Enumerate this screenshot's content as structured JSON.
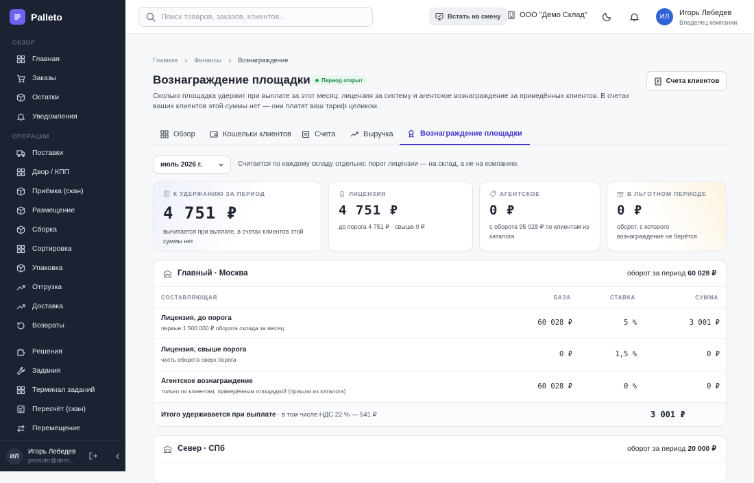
{
  "app": {
    "name": "Palleto"
  },
  "sidebar": {
    "section_overview": "ОБЗОР",
    "section_ops": "ОПЕРАЦИИ",
    "overview_items": [
      {
        "label": "Главная"
      },
      {
        "label": "Заказы"
      },
      {
        "label": "Остатки"
      },
      {
        "label": "Уведомления"
      }
    ],
    "ops_items": [
      {
        "label": "Поставки"
      },
      {
        "label": "Двор / КПП"
      },
      {
        "label": "Приёмка (скан)"
      },
      {
        "label": "Размещение"
      },
      {
        "label": "Сборка"
      },
      {
        "label": "Сортировка"
      },
      {
        "label": "Упаковка"
      },
      {
        "label": "Отгрузка"
      },
      {
        "label": "Доставка"
      },
      {
        "label": "Возвраты"
      }
    ],
    "other_items": [
      {
        "label": "Решения"
      },
      {
        "label": "Задания"
      },
      {
        "label": "Терминал заданий"
      },
      {
        "label": "Пересчёт (скан)"
      },
      {
        "label": "Перемещение"
      }
    ],
    "user": {
      "initials": "ИЛ",
      "name": "Игорь Лебедев",
      "email": "provider@dem..."
    }
  },
  "topbar": {
    "search_placeholder": "Поиск товаров, заказов, клиентов...",
    "shift_label": "Встать на смену",
    "org": "ООО \"Демо Склад\"",
    "user": {
      "initials": "ИЛ",
      "name": "Игорь Лебедев",
      "role": "Владелец компании"
    }
  },
  "breadcrumbs": [
    "Главная",
    "Финансы",
    "Вознаграждение"
  ],
  "page": {
    "title": "Вознаграждение площадки",
    "badge": "Период открыт",
    "description": "Сколько площадка удержит при выплате за этот месяц: лицензия за систему и агентское вознаграждение за приведённых клиентов. В счетах ваших клиентов этой суммы нет — они платят ваш тариф целиком.",
    "accounts_button": "Счета клиентов"
  },
  "tabs": [
    {
      "label": "Обзор",
      "icon": "grid-icon",
      "active": false
    },
    {
      "label": "Кошельки клиентов",
      "icon": "wallet-icon",
      "active": false
    },
    {
      "label": "Счета",
      "icon": "invoice-icon",
      "active": false
    },
    {
      "label": "Выручка",
      "icon": "trend-icon",
      "active": false
    },
    {
      "label": "Вознаграждение площадки",
      "icon": "award-icon",
      "active": true
    }
  ],
  "filter": {
    "month": "июль 2026 г.",
    "note": "Считается по каждому складу отдельно: порог лицензии — на склад, а не на компанию."
  },
  "cards": [
    {
      "title": "К УДЕРЖАНИЮ ЗА ПЕРИОД",
      "value": "4 751 ₽",
      "note": "вычитается при выплате, в счетах клиентов этой суммы нет"
    },
    {
      "title": "ЛИЦЕНЗИЯ",
      "value": "4 751 ₽",
      "note": "до порога 4 751 ₽ · свыше 0 ₽"
    },
    {
      "title": "АГЕНТСКОЕ",
      "value": "0 ₽",
      "note": "с оборота 95 028 ₽ по клиентам из каталога"
    },
    {
      "title": "В ЛЬГОТНОМ ПЕРИОДЕ",
      "value": "0 ₽",
      "note": "оборот, с которого вознаграждение не берётся"
    }
  ],
  "warehouses": [
    {
      "name": "Главный · Москва",
      "turnover_label": "оборот за период",
      "turnover": "60 028 ₽",
      "columns": [
        "СОСТАВЛЯЮЩАЯ",
        "БАЗА",
        "СТАВКА",
        "СУММА"
      ],
      "rows": [
        {
          "name": "Лицензия, до порога",
          "sub": "первые 1 500 000 ₽ оборота склада за месяц",
          "base": "60 028 ₽",
          "rate": "5 %",
          "sum": "3 001 ₽"
        },
        {
          "name": "Лицензия, свыше порога",
          "sub": "часть оборота сверх порога",
          "base": "0 ₽",
          "rate": "1,5 %",
          "sum": "0 ₽"
        },
        {
          "name": "Агентское вознаграждение",
          "sub": "только по клиентам, приведённым площадкой (пришли из каталога)",
          "base": "60 028 ₽",
          "rate": "0 %",
          "sum": "0 ₽"
        }
      ],
      "total_label": "Итого удерживается при выплате",
      "total_note": " · в том числе НДС 22 % — 541 ₽",
      "total": "3 001 ₽"
    },
    {
      "name": "Север · СПб",
      "turnover_label": "оборот за период",
      "turnover": "20 000 ₽"
    }
  ]
}
